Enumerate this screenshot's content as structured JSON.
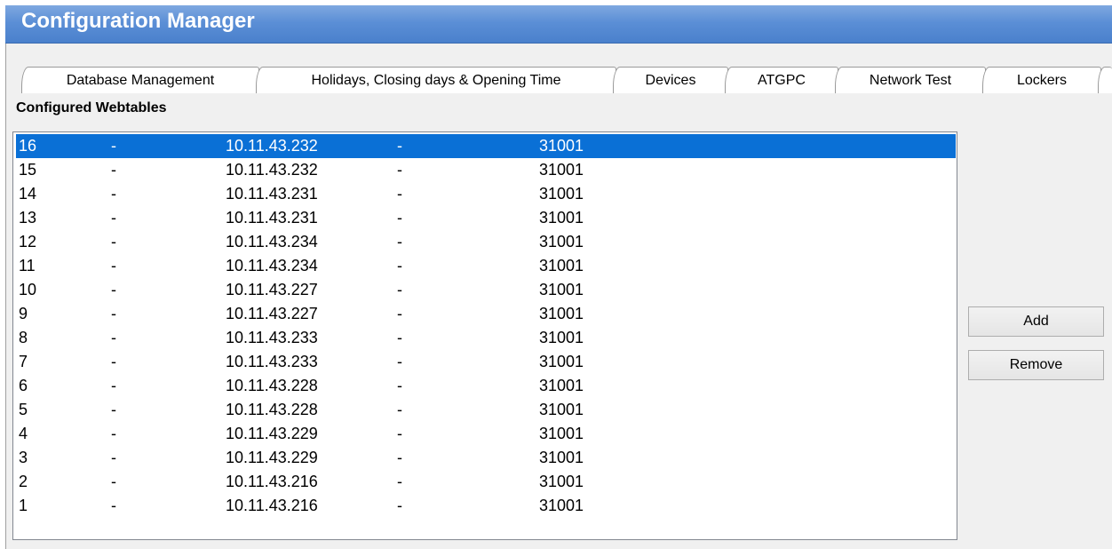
{
  "window": {
    "title": "Configuration Manager"
  },
  "tabs": [
    {
      "label": "Database Management"
    },
    {
      "label": "Holidays, Closing days & Opening Time"
    },
    {
      "label": "Devices"
    },
    {
      "label": "ATGPC"
    },
    {
      "label": "Network Test"
    },
    {
      "label": "Lockers"
    }
  ],
  "panel": {
    "section_label": "Configured Webtables",
    "list": {
      "selected_index": 0,
      "rows": [
        {
          "id": "16",
          "sep1": "-",
          "ip": "10.11.43.232",
          "sep2": "-",
          "port": "31001"
        },
        {
          "id": "15",
          "sep1": "-",
          "ip": "10.11.43.232",
          "sep2": "-",
          "port": "31001"
        },
        {
          "id": "14",
          "sep1": "-",
          "ip": "10.11.43.231",
          "sep2": "-",
          "port": "31001"
        },
        {
          "id": "13",
          "sep1": "-",
          "ip": "10.11.43.231",
          "sep2": "-",
          "port": "31001"
        },
        {
          "id": "12",
          "sep1": "-",
          "ip": "10.11.43.234",
          "sep2": "-",
          "port": "31001"
        },
        {
          "id": "11",
          "sep1": "-",
          "ip": "10.11.43.234",
          "sep2": "-",
          "port": "31001"
        },
        {
          "id": "10",
          "sep1": "-",
          "ip": "10.11.43.227",
          "sep2": "-",
          "port": "31001"
        },
        {
          "id": "9",
          "sep1": "-",
          "ip": "10.11.43.227",
          "sep2": "-",
          "port": "31001"
        },
        {
          "id": "8",
          "sep1": "-",
          "ip": "10.11.43.233",
          "sep2": "-",
          "port": "31001"
        },
        {
          "id": "7",
          "sep1": "-",
          "ip": "10.11.43.233",
          "sep2": "-",
          "port": "31001"
        },
        {
          "id": "6",
          "sep1": "-",
          "ip": "10.11.43.228",
          "sep2": "-",
          "port": "31001"
        },
        {
          "id": "5",
          "sep1": "-",
          "ip": "10.11.43.228",
          "sep2": "-",
          "port": "31001"
        },
        {
          "id": "4",
          "sep1": "-",
          "ip": "10.11.43.229",
          "sep2": "-",
          "port": "31001"
        },
        {
          "id": "3",
          "sep1": "-",
          "ip": "10.11.43.229",
          "sep2": "-",
          "port": "31001"
        },
        {
          "id": "2",
          "sep1": "-",
          "ip": "10.11.43.216",
          "sep2": "-",
          "port": "31001"
        },
        {
          "id": "1",
          "sep1": "-",
          "ip": "10.11.43.216",
          "sep2": "-",
          "port": "31001"
        }
      ]
    },
    "buttons": {
      "add_label": "Add",
      "remove_label": "Remove"
    }
  },
  "colors": {
    "title_bar": "#5b8fd6",
    "selection": "#0a70d6"
  }
}
